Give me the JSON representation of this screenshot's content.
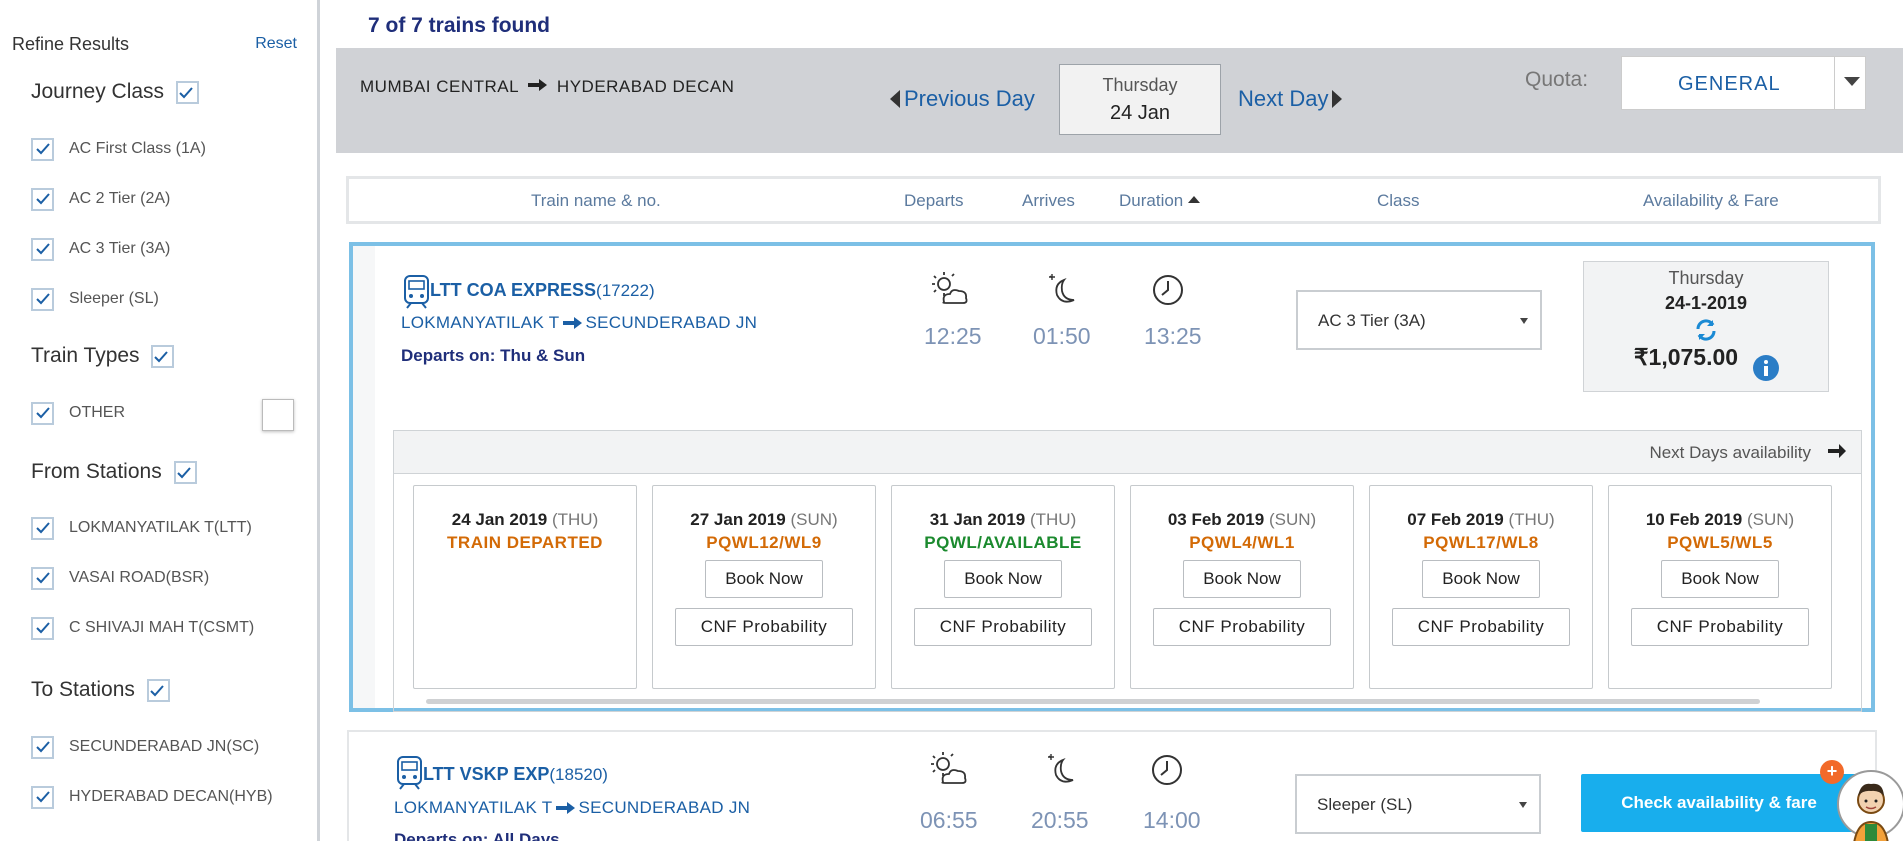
{
  "results": {
    "count_text": "7 of 7 trains found"
  },
  "sidebar": {
    "title": "Refine Results",
    "reset_label": "Reset",
    "journey_class": {
      "title": "Journey Class",
      "items": [
        {
          "label": "AC First Class (1A)",
          "checked": true
        },
        {
          "label": "AC 2 Tier (2A)",
          "checked": true
        },
        {
          "label": "AC 3 Tier (3A)",
          "checked": true
        },
        {
          "label": "Sleeper (SL)",
          "checked": true
        }
      ]
    },
    "train_types": {
      "title": "Train Types",
      "items": [
        {
          "label": "OTHER",
          "checked": true
        }
      ]
    },
    "from_stations": {
      "title": "From Stations",
      "items": [
        {
          "label": "LOKMANYATILAK T(LTT)",
          "checked": true
        },
        {
          "label": "VASAI ROAD(BSR)",
          "checked": true
        },
        {
          "label": "C SHIVAJI MAH T(CSMT)",
          "checked": true
        }
      ]
    },
    "to_stations": {
      "title": "To Stations",
      "items": [
        {
          "label": "SECUNDERABAD JN(SC)",
          "checked": true
        },
        {
          "label": "HYDERABAD DECAN(HYB)",
          "checked": true
        }
      ]
    }
  },
  "search": {
    "from": "MUMBAI CENTRAL",
    "to": "HYDERABAD DECAN",
    "prev_day_label": "Previous Day",
    "next_day_label": "Next Day",
    "date_weekday": "Thursday",
    "date_day": "24 Jan",
    "quota_label": "Quota:",
    "quota_value": "GENERAL"
  },
  "columns": {
    "train": "Train name & no.",
    "departs": "Departs",
    "arrives": "Arrives",
    "duration": "Duration",
    "class": "Class",
    "availability": "Availability & Fare"
  },
  "trains": [
    {
      "name": "LTT COA EXPRESS",
      "number": "(17222)",
      "from": "LOKMANYATILAK T",
      "to": "SECUNDERABAD JN",
      "runs": "Departs on: Thu & Sun",
      "departs": "12:25",
      "arrives": "01:50",
      "duration": "13:25",
      "class_selected": "AC 3 Tier (3A)",
      "fare_weekday": "Thursday",
      "fare_date": "24-1-2019",
      "fare": "₹1,075.00",
      "next_days_label": "Next Days availability",
      "availability": [
        {
          "date": "24 Jan 2019",
          "dow": "(THU)",
          "status": "TRAIN DEPARTED",
          "status_color": "#d36a06",
          "book": "",
          "cnf": ""
        },
        {
          "date": "27 Jan 2019",
          "dow": "(SUN)",
          "status": "PQWL12/WL9",
          "status_color": "#d36a06",
          "book": "Book Now",
          "cnf": "CNF Probability"
        },
        {
          "date": "31 Jan 2019",
          "dow": "(THU)",
          "status": "PQWL/AVAILABLE",
          "status_color": "#1b8a2e",
          "book": "Book Now",
          "cnf": "CNF Probability"
        },
        {
          "date": "03 Feb 2019",
          "dow": "(SUN)",
          "status": "PQWL4/WL1",
          "status_color": "#d36a06",
          "book": "Book Now",
          "cnf": "CNF Probability"
        },
        {
          "date": "07 Feb 2019",
          "dow": "(THU)",
          "status": "PQWL17/WL8",
          "status_color": "#d36a06",
          "book": "Book Now",
          "cnf": "CNF Probability"
        },
        {
          "date": "10 Feb 2019",
          "dow": "(SUN)",
          "status": "PQWL5/WL5",
          "status_color": "#d36a06",
          "book": "Book Now",
          "cnf": "CNF Probability"
        }
      ]
    },
    {
      "name": "LTT VSKP EXP",
      "number": "(18520)",
      "from": "LOKMANYATILAK T",
      "to": "SECUNDERABAD JN",
      "runs": "Departs on: All Days",
      "departs": "06:55",
      "arrives": "20:55",
      "duration": "14:00",
      "class_selected": "Sleeper (SL)",
      "check_label": "Check availability & fare"
    }
  ],
  "colors": {
    "accent": "#1b5fa5",
    "highlight_border": "#7cc0e6",
    "cta": "#18aeed",
    "waitlist": "#d36a06",
    "available": "#1b8a2e"
  }
}
